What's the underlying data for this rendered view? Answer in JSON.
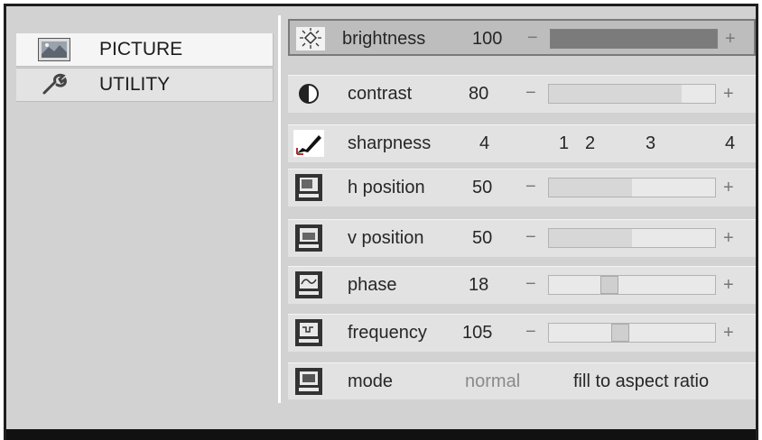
{
  "tabs": [
    {
      "label": "PICTURE",
      "icon": "picture-icon",
      "selected": true
    },
    {
      "label": "UTILITY",
      "icon": "wrench-icon",
      "selected": false
    }
  ],
  "settings": {
    "brightness": {
      "label": "brightness",
      "value": "100",
      "minus": "−",
      "plus": "+",
      "level": 1.0,
      "icon": "brightness-icon"
    },
    "contrast": {
      "label": "contrast",
      "value": "80",
      "minus": "−",
      "plus": "+",
      "level": 0.8,
      "icon": "contrast-icon"
    },
    "sharpness": {
      "label": "sharpness",
      "value": "4",
      "options": [
        "1",
        "2",
        "3",
        "4"
      ],
      "icon": "sharpness-icon"
    },
    "h_position": {
      "label": "h position",
      "value": "50",
      "minus": "−",
      "plus": "+",
      "level": 0.5,
      "icon": "monitor-icon"
    },
    "v_position": {
      "label": "v position",
      "value": "50",
      "minus": "−",
      "plus": "+",
      "level": 0.5,
      "icon": "monitor-icon"
    },
    "phase": {
      "label": "phase",
      "value": "18",
      "minus": "−",
      "plus": "+",
      "level": 0.35,
      "icon": "phase-icon"
    },
    "frequency": {
      "label": "frequency",
      "value": "105",
      "minus": "−",
      "plus": "+",
      "level": 0.42,
      "icon": "frequency-icon"
    },
    "mode": {
      "label": "mode",
      "option_normal": "normal",
      "option_fill": "fill to aspect ratio",
      "icon": "monitor-icon"
    }
  },
  "colors": {
    "panel": "#d2d2d2",
    "row": "#e2e2e2",
    "selected_row": "#bdbdbd",
    "frame": "#1e1e1e"
  }
}
